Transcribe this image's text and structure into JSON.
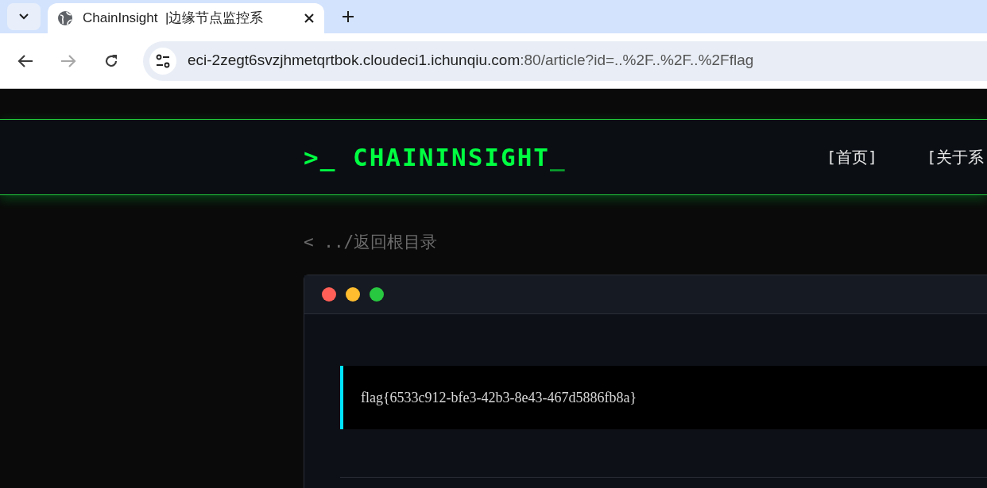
{
  "browser": {
    "tab_title": "ChainInsight  |边缘节点监控系",
    "url_host": "eci-2zegt6svzjhmetqrtbok.cloudeci1.ichunqiu.com",
    "url_rest": ":80/article?id=..%2F..%2F..%2Fflag"
  },
  "header": {
    "logo_prompt": ">_",
    "logo_text": "CHAININSIGHT",
    "logo_cursor": "_",
    "nav": [
      {
        "label": "[首页]"
      },
      {
        "label": "[关于系"
      }
    ]
  },
  "back_link": {
    "arrow": "<",
    "text": "../返回根目录"
  },
  "article": {
    "content": "flag{6533c912-bfe3-42b3-8e43-467d5886fb8a}"
  }
}
